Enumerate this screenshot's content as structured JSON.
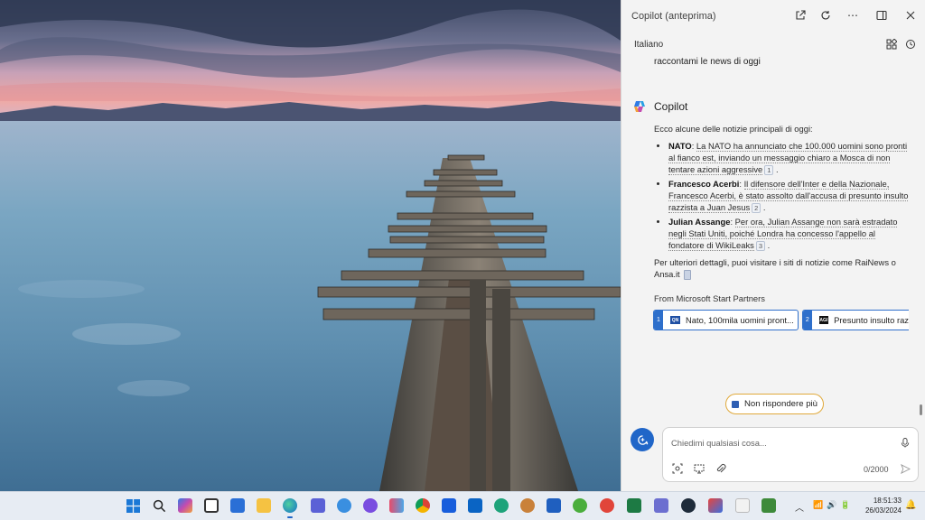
{
  "copilot": {
    "window_title": "Copilot (anteprima)",
    "language": "Italiano",
    "user_message": "raccontami le news di oggi",
    "assistant_name": "Copilot",
    "answer": {
      "intro": "Ecco alcune delle notizie principali di oggi:",
      "items": [
        {
          "topic": "NATO",
          "text": "La NATO ha annunciato che 100.000 uomini sono pronti al fianco est, inviando un messaggio chiaro a Mosca di non tentare azioni aggressive",
          "cite": "1"
        },
        {
          "topic": "Francesco Acerbi",
          "text": "Il difensore dell'Inter e della Nazionale, Francesco Acerbi, è stato assolto dall'accusa di presunto insulto razzista a Juan Jesus",
          "cite": "2"
        },
        {
          "topic": "Julian Assange",
          "text": "Per ora, Julian Assange non sarà estradato negli Stati Uniti, poiché Londra ha concesso l'appello al fondatore di WikiLeaks",
          "cite": "3"
        }
      ],
      "outro": "Per ulteriori dettagli, puoi visitare i siti di notizie come RaiNews o Ansa.it"
    },
    "partners_label": "From Microsoft Start Partners",
    "news_cards": [
      {
        "index": "1",
        "source_abbr": "QN",
        "title": "Nato, 100mila uomini pront..."
      },
      {
        "index": "2",
        "source_abbr": "AGI",
        "title": "Presunto insulto raz"
      }
    ],
    "stop_button": "Non rispondere più",
    "composer": {
      "placeholder": "Chiedimi qualsiasi cosa...",
      "value": "",
      "counter": "0/2000"
    }
  },
  "taskbar": {
    "time": "18:51:33",
    "date": "26/03/2024",
    "apps": [
      "start",
      "search",
      "copilot",
      "task-view",
      "store",
      "file-explorer",
      "edge",
      "app",
      "app",
      "app",
      "app",
      "chrome",
      "bitwarden",
      "outlook",
      "app",
      "app",
      "outlook",
      "app",
      "app",
      "excel",
      "app",
      "app",
      "app",
      "app",
      "app"
    ]
  },
  "colors": {
    "accent": "#2066c8",
    "stop_border": "#e0a93b",
    "pane_bg": "#f3f3f3"
  }
}
